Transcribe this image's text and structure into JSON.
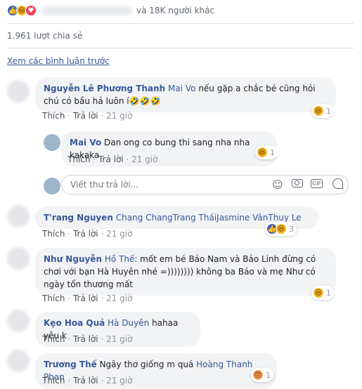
{
  "reactions_bar": {
    "icons": [
      "like-icon",
      "haha-icon",
      "love-icon"
    ],
    "others_text": "và 18K người khác"
  },
  "share_count": "1.961 lượt chia sẻ",
  "view_previous": "Xem các bình luận trước",
  "comments": [
    {
      "author": "Nguyễn Lê Phương Thanh",
      "tag": "Mai Vo",
      "text": "nếu gặp a chắc bé cũng hỏi chú có bầu hả luôn í🤣🤣🤣",
      "like": "Thích",
      "reply": "Trả lời",
      "time": "21 giờ",
      "reaction_count": "1"
    },
    {
      "author": "Mai Vo",
      "text": "Dan ong co bung thi sang nha nha kakaka",
      "like": "Thích",
      "reply": "Trả lời",
      "time": "21 giờ",
      "reaction_count": "1"
    },
    {
      "author": "T'rang Nguyen",
      "tag": "Chang ChangTrang TháiJasmine VânThuy Le",
      "like": "Thích",
      "reply": "Trả lời",
      "time": "21 giờ",
      "reaction_count": "3"
    },
    {
      "author": "Như Nguyễn",
      "tag": "Hồ Thế",
      "text": ": mốt em bé Bảo Nam và Bảo Linh đừng có chơi với bạn Hà Huyên nhé =)))))))) không ba Bảo và mẹ Như có ngày tổn thương mất",
      "like": "Thích",
      "reply": "Trả lời",
      "time": "21 giờ",
      "reaction_count": "1"
    },
    {
      "author": "Kẹo Hoa Quả",
      "tag": "Hà Duyên",
      "text": "hahaa yêu k",
      "like": "Thích",
      "reply": "Trả lời",
      "time": "21 giờ"
    },
    {
      "author": "Trương Thế",
      "text": "Ngây thơ giống m quá",
      "tag": "Hoàng Thanh Phan",
      "like": "Thích",
      "reply": "Trả lời",
      "time": "21 giờ",
      "reaction_count": "1"
    }
  ],
  "reply_input": {
    "placeholder": "Viết thư trả lời...",
    "icons": [
      "emoji-icon",
      "camera-icon",
      "gif-icon",
      "sticker-icon"
    ],
    "gif_label": "GIF"
  },
  "colors": {
    "link": "#385898",
    "bubble": "#f2f3f5",
    "meta": "#90949c",
    "like_blue": "#4267b2",
    "haha_yellow": "#f7b928",
    "love_red": "#f33e58"
  }
}
